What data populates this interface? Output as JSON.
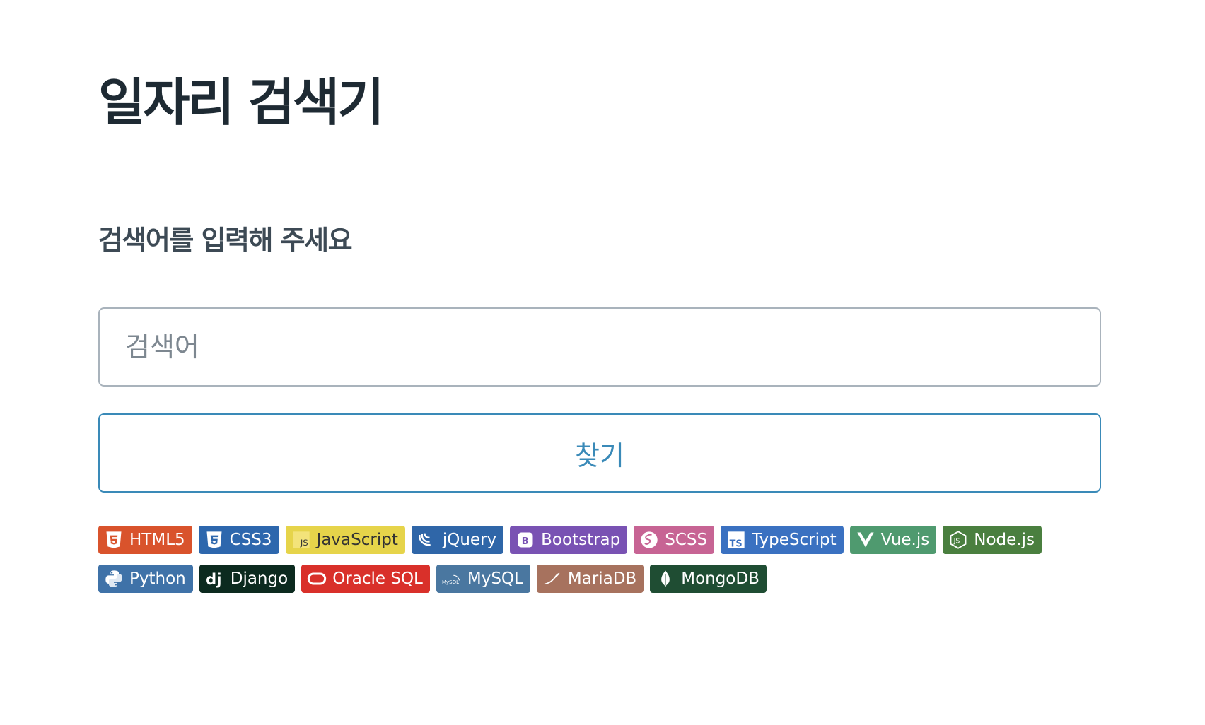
{
  "header": {
    "title": "일자리 검색기",
    "subtitle": "검색어를 입력해 주세요"
  },
  "search": {
    "placeholder": "검색어",
    "value": "",
    "button_label": "찾기"
  },
  "badges": [
    {
      "label": "HTML5",
      "icon": "html5-icon",
      "color": "#d9532c"
    },
    {
      "label": "CSS3",
      "icon": "css3-icon",
      "color": "#2d67ad"
    },
    {
      "label": "JavaScript",
      "icon": "javascript-icon",
      "color": "#e6d44a",
      "text_color": "#333333"
    },
    {
      "label": "jQuery",
      "icon": "jquery-icon",
      "color": "#2f66a8"
    },
    {
      "label": "Bootstrap",
      "icon": "bootstrap-icon",
      "color": "#7952b3"
    },
    {
      "label": "SCSS",
      "icon": "sass-icon",
      "color": "#c76494"
    },
    {
      "label": "TypeScript",
      "icon": "typescript-icon",
      "color": "#3a71c1"
    },
    {
      "label": "Vue.js",
      "icon": "vuejs-icon",
      "color": "#4f9a6f"
    },
    {
      "label": "Node.js",
      "icon": "nodejs-icon",
      "color": "#4a7f3f"
    },
    {
      "label": "Python",
      "icon": "python-icon",
      "color": "#3f72a8"
    },
    {
      "label": "Django",
      "icon": "django-icon",
      "color": "#0c2a1f"
    },
    {
      "label": "Oracle SQL",
      "icon": "oracle-icon",
      "color": "#d9302a"
    },
    {
      "label": "MySQL",
      "icon": "mysql-icon",
      "color": "#4a77a0"
    },
    {
      "label": "MariaDB",
      "icon": "mariadb-icon",
      "color": "#a7725e"
    },
    {
      "label": "MongoDB",
      "icon": "mongodb-icon",
      "color": "#1f4d33"
    }
  ]
}
